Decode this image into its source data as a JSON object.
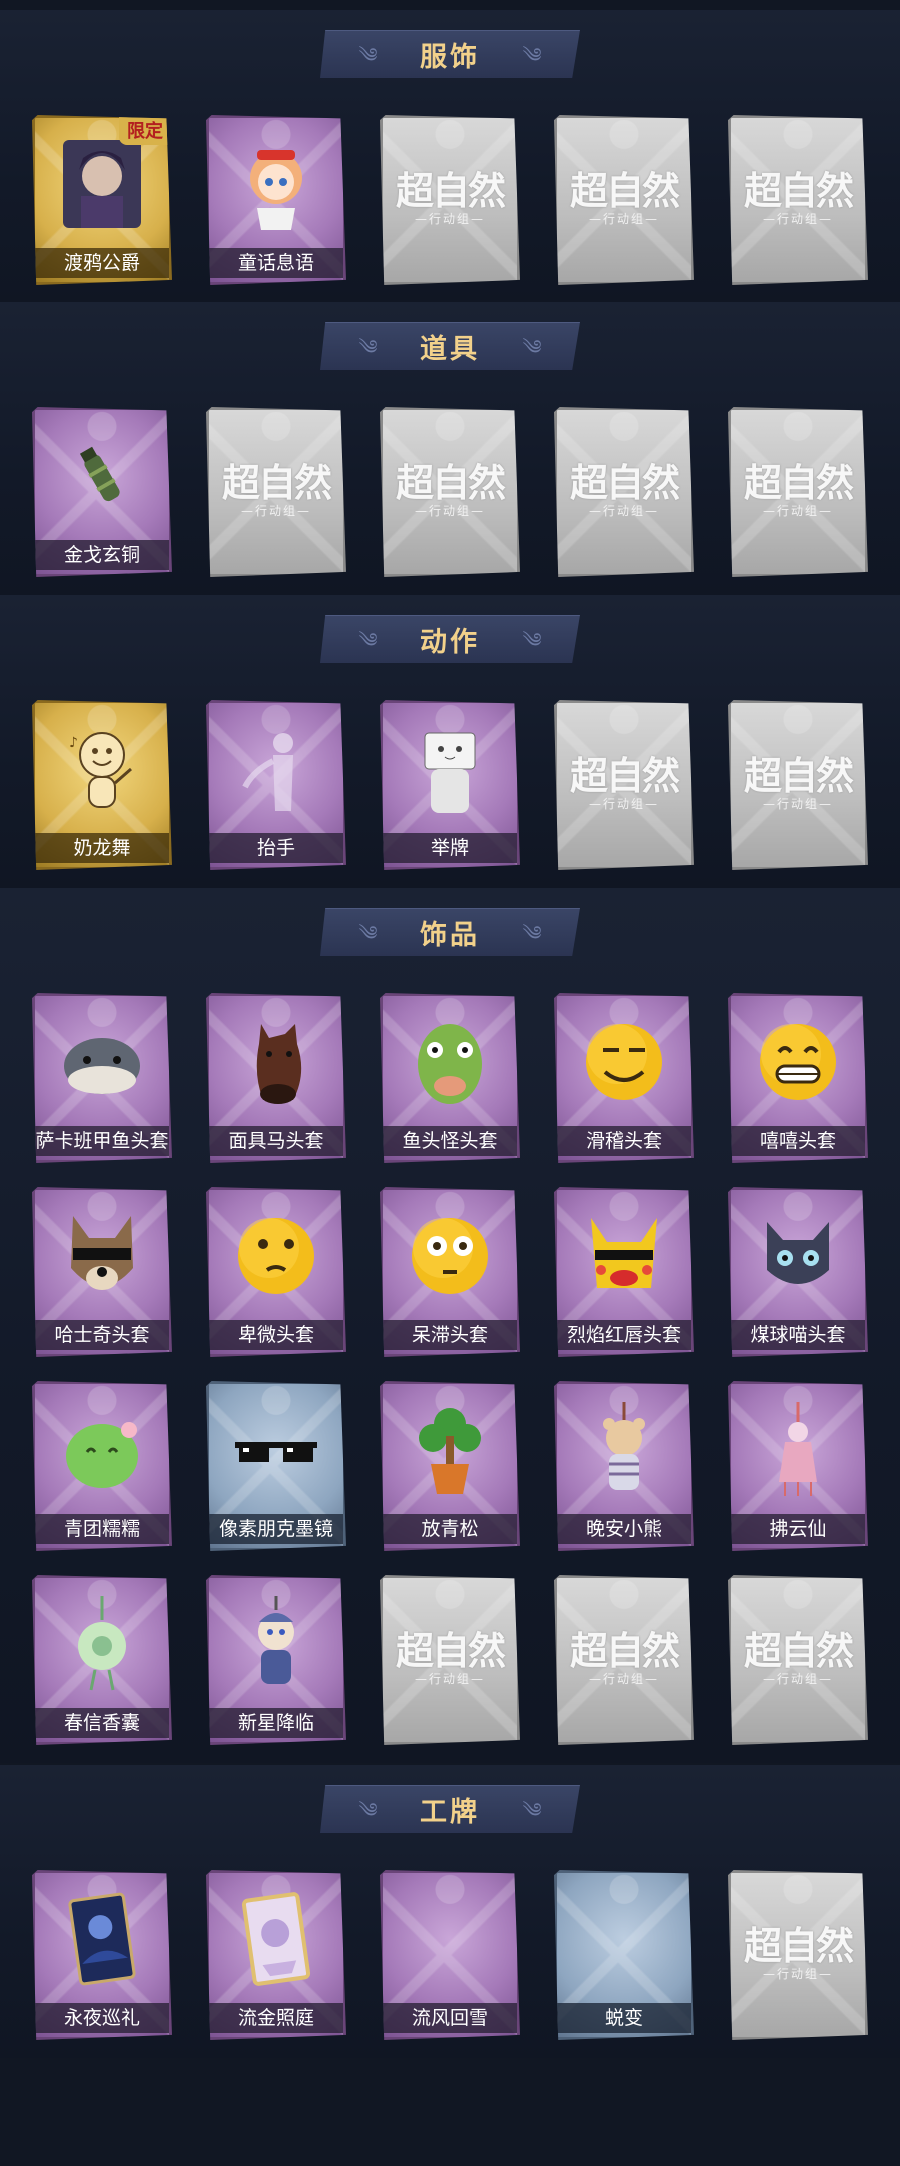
{
  "sections": [
    {
      "title": "服饰",
      "items": [
        {
          "label": "渡鸦公爵",
          "rarity": "gold",
          "badge": "限定",
          "art": "portrait-dark"
        },
        {
          "label": "童话息语",
          "rarity": "purple",
          "art": "portrait-girl"
        },
        {
          "locked": true
        },
        {
          "locked": true
        },
        {
          "locked": true
        }
      ]
    },
    {
      "title": "道具",
      "items": [
        {
          "label": "金戈玄铜",
          "rarity": "purple",
          "art": "bottle"
        },
        {
          "locked": true
        },
        {
          "locked": true
        },
        {
          "locked": true
        },
        {
          "locked": true
        }
      ]
    },
    {
      "title": "动作",
      "items": [
        {
          "label": "奶龙舞",
          "rarity": "gold",
          "art": "dancer"
        },
        {
          "label": "抬手",
          "rarity": "purple",
          "art": "silhouette"
        },
        {
          "label": "举牌",
          "rarity": "purple",
          "art": "sign"
        },
        {
          "locked": true
        },
        {
          "locked": true
        }
      ]
    },
    {
      "title": "饰品",
      "items": [
        {
          "label": "萨卡班甲鱼头套",
          "rarity": "purple",
          "art": "fish"
        },
        {
          "label": "面具马头套",
          "rarity": "purple",
          "art": "horse"
        },
        {
          "label": "鱼头怪头套",
          "rarity": "purple",
          "art": "fishman"
        },
        {
          "label": "滑稽头套",
          "rarity": "purple",
          "art": "emoji-smirk"
        },
        {
          "label": "嘻嘻头套",
          "rarity": "purple",
          "art": "emoji-grin"
        },
        {
          "label": "哈士奇头套",
          "rarity": "purple",
          "art": "dog"
        },
        {
          "label": "卑微头套",
          "rarity": "purple",
          "art": "emoji-humble"
        },
        {
          "label": "呆滞头套",
          "rarity": "purple",
          "art": "emoji-stare"
        },
        {
          "label": "烈焰红唇头套",
          "rarity": "purple",
          "art": "pika"
        },
        {
          "label": "煤球喵头套",
          "rarity": "purple",
          "art": "cat"
        },
        {
          "label": "青团糯糯",
          "rarity": "purple",
          "art": "dumpling"
        },
        {
          "label": "像素朋克墨镜",
          "rarity": "blue",
          "art": "glasses"
        },
        {
          "label": "放青松",
          "rarity": "purple",
          "art": "tree"
        },
        {
          "label": "晚安小熊",
          "rarity": "purple",
          "art": "bear"
        },
        {
          "label": "拂云仙",
          "rarity": "purple",
          "art": "charm"
        },
        {
          "label": "春信香囊",
          "rarity": "purple",
          "art": "sachet"
        },
        {
          "label": "新星降临",
          "rarity": "purple",
          "art": "keychain"
        },
        {
          "locked": true
        },
        {
          "locked": true
        },
        {
          "locked": true
        }
      ]
    },
    {
      "title": "工牌",
      "items": [
        {
          "label": "永夜巡礼",
          "rarity": "purple",
          "art": "card-night"
        },
        {
          "label": "流金照庭",
          "rarity": "purple",
          "art": "card-gold"
        },
        {
          "label": "流风回雪",
          "rarity": "purple",
          "art": "blank"
        },
        {
          "label": "蜕变",
          "rarity": "blue",
          "art": "blank"
        },
        {
          "locked": true
        }
      ]
    }
  ],
  "locked_card": {
    "main": "超自然",
    "sub": "—行动组—"
  },
  "colors": {
    "background": "#111723",
    "banner": "#2f3958",
    "banner_text": "#f2d18b"
  }
}
